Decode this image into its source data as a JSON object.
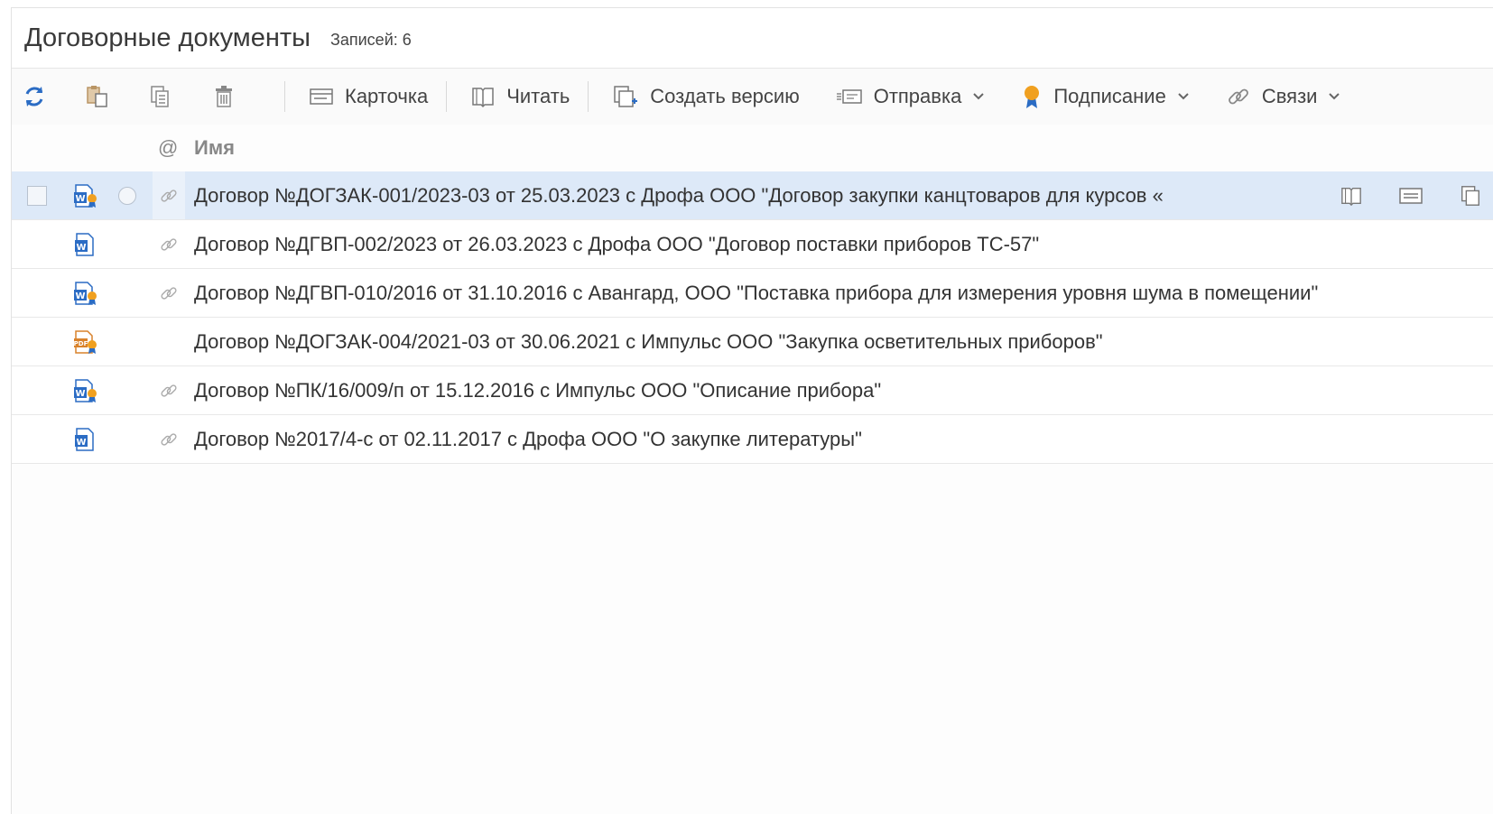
{
  "header": {
    "title": "Договорные документы",
    "count": "Записей: 6"
  },
  "toolbar": {
    "card_label": "Карточка",
    "read_label": "Читать",
    "create_version_label": "Создать версию",
    "send_label": "Отправка",
    "sign_label": "Подписание",
    "links_label": "Связи"
  },
  "columns": {
    "at": "@",
    "name": "Имя"
  },
  "rows": [
    {
      "name": "Договор №ДОГЗАК-001/2023-03 от 25.03.2023 с Дрофа ООО \"Договор закупки канцтоваров для курсов «",
      "doc_type": "word-signed",
      "has_link": true,
      "selected": true
    },
    {
      "name": "Договор №ДГВП-002/2023 от 26.03.2023 с Дрофа ООО \"Договор поставки приборов ТС-57\"",
      "doc_type": "word",
      "has_link": true,
      "selected": false
    },
    {
      "name": "Договор №ДГВП-010/2016 от 31.10.2016 с Авангард, ООО \"Поставка прибора для измерения уровня шума в помещении\"",
      "doc_type": "word-signed",
      "has_link": true,
      "selected": false
    },
    {
      "name": "Договор №ДОГЗАК-004/2021-03 от 30.06.2021 с Импульс ООО \"Закупка осветительных приборов\"",
      "doc_type": "pdf-signed",
      "has_link": false,
      "selected": false
    },
    {
      "name": "Договор №ПК/16/009/п от 15.12.2016 с Импульс ООО \"Описание прибора\"",
      "doc_type": "word-signed",
      "has_link": true,
      "selected": false
    },
    {
      "name": "Договор №2017/4-с от 02.11.2017 с Дрофа ООО \"О закупке литературы\"",
      "doc_type": "word",
      "has_link": true,
      "selected": false
    }
  ],
  "colors": {
    "accent": "#2b6cc4",
    "selected_row": "#dde9f8",
    "sign_badge": "#f0a020",
    "pdf": "#d9822b"
  }
}
